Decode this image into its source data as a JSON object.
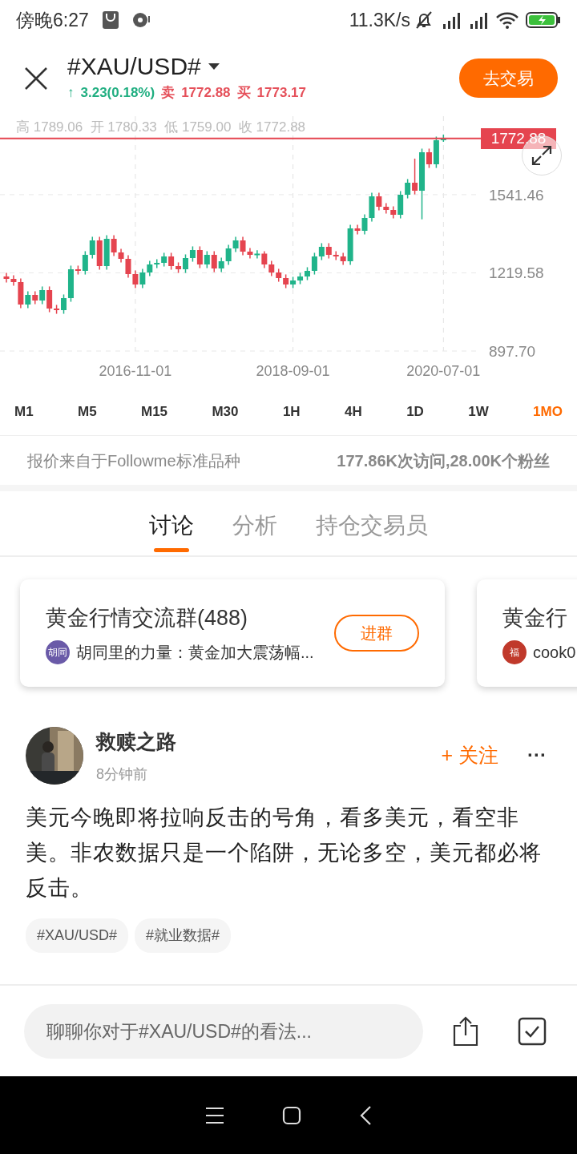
{
  "status_bar": {
    "time": "傍晚6:27",
    "net_speed": "11.3K/s"
  },
  "header": {
    "title": "#XAU/USD#",
    "arrow": "↑",
    "change": "3.23(0.18%)",
    "sell_label": "卖",
    "sell": "1772.88",
    "buy_label": "买",
    "buy": "1773.17",
    "trade_button": "去交易"
  },
  "chart": {
    "ohlc": "高 1789.06  开 1780.33  低 1759.00  收 1772.88",
    "price_tag": "1772.88",
    "chart_data": {
      "type": "candlestick",
      "grid": true,
      "ylim": [
        897.7,
        1864.6
      ],
      "yticks": [
        {
          "value": 1541.46,
          "label": "1541.46"
        },
        {
          "value": 1219.58,
          "label": "1219.58"
        },
        {
          "value": 897.7,
          "label": "897.70"
        }
      ],
      "categories": [
        null,
        null,
        null,
        null,
        null,
        null,
        null,
        null,
        null,
        null,
        null,
        null,
        null,
        null,
        null,
        null,
        null,
        null,
        "2016-11-01",
        null,
        null,
        null,
        null,
        null,
        null,
        null,
        null,
        null,
        null,
        null,
        null,
        null,
        null,
        null,
        null,
        null,
        null,
        null,
        null,
        null,
        "2018-09-01",
        null,
        null,
        null,
        null,
        null,
        null,
        null,
        null,
        null,
        null,
        null,
        null,
        null,
        null,
        null,
        null,
        null,
        null,
        null,
        null,
        "2020-07-01"
      ],
      "ohlc": [
        [
          1204.6,
          1219.6,
          1179.7,
          1194.7
        ],
        [
          1194.7,
          1209.7,
          1166.5,
          1181.5
        ],
        [
          1181.5,
          1196.5,
          1074.1,
          1089.1
        ],
        [
          1089.1,
          1143.7,
          1074.1,
          1128.7
        ],
        [
          1128.7,
          1143.7,
          1090.6,
          1105.6
        ],
        [
          1105.6,
          1163.5,
          1090.6,
          1148.5
        ],
        [
          1148.5,
          1163.5,
          1057.6,
          1072.6
        ],
        [
          1072.6,
          1087.6,
          1051.0,
          1066.0
        ],
        [
          1066.0,
          1130.5,
          1051.0,
          1115.5
        ],
        [
          1115.5,
          1249.3,
          1100.5,
          1234.3
        ],
        [
          1234.3,
          1249.3,
          1212.7,
          1227.7
        ],
        [
          1227.7,
          1308.7,
          1212.7,
          1293.7
        ],
        [
          1293.7,
          1368.1,
          1278.7,
          1353.1
        ],
        [
          1353.1,
          1368.1,
          1232.5,
          1247.5
        ],
        [
          1247.5,
          1374.7,
          1232.5,
          1359.7
        ],
        [
          1359.7,
          1374.7,
          1288.6,
          1303.6
        ],
        [
          1303.6,
          1318.6,
          1262.2,
          1277.2
        ],
        [
          1277.2,
          1292.2,
          1199.5,
          1214.5
        ],
        [
          1214.5,
          1229.5,
          1156.6,
          1171.6
        ],
        [
          1171.6,
          1236.1,
          1156.6,
          1221.1
        ],
        [
          1221.1,
          1269.1,
          1206.1,
          1254.1
        ],
        [
          1254.1,
          1275.7,
          1239.1,
          1260.7
        ],
        [
          1260.7,
          1302.1,
          1245.7,
          1287.1
        ],
        [
          1287.1,
          1302.1,
          1232.5,
          1247.5
        ],
        [
          1247.5,
          1262.5,
          1219.3,
          1234.3
        ],
        [
          1234.3,
          1295.5,
          1219.3,
          1280.5
        ],
        [
          1280.5,
          1328.5,
          1265.5,
          1313.5
        ],
        [
          1313.5,
          1328.5,
          1239.1,
          1254.1
        ],
        [
          1254.1,
          1308.7,
          1239.1,
          1293.7
        ],
        [
          1293.7,
          1308.7,
          1222.6,
          1237.6
        ],
        [
          1237.6,
          1282.3,
          1222.6,
          1267.3
        ],
        [
          1267.3,
          1335.1,
          1252.3,
          1320.1
        ],
        [
          1320.1,
          1368.1,
          1305.1,
          1353.1
        ],
        [
          1353.1,
          1368.1,
          1291.9,
          1306.9
        ],
        [
          1306.9,
          1321.9,
          1278.7,
          1293.7
        ],
        [
          1293.7,
          1312.7,
          1278.7,
          1298.7
        ],
        [
          1298.7,
          1308.7,
          1239.1,
          1254.1
        ],
        [
          1254.1,
          1269.1,
          1206.1,
          1221.1
        ],
        [
          1221.1,
          1236.1,
          1183.0,
          1198.0
        ],
        [
          1198.0,
          1213.0,
          1156.6,
          1171.6
        ],
        [
          1171.6,
          1203.1,
          1156.6,
          1188.1
        ],
        [
          1188.1,
          1219.6,
          1173.1,
          1204.6
        ],
        [
          1204.6,
          1242.7,
          1189.6,
          1227.7
        ],
        [
          1227.7,
          1302.1,
          1212.7,
          1287.1
        ],
        [
          1287.1,
          1341.7,
          1272.1,
          1326.7
        ],
        [
          1326.7,
          1341.7,
          1278.7,
          1293.7
        ],
        [
          1293.7,
          1308.7,
          1272.1,
          1287.1
        ],
        [
          1287.1,
          1302.1,
          1252.3,
          1267.3
        ],
        [
          1267.3,
          1417.6,
          1252.3,
          1402.6
        ],
        [
          1402.6,
          1417.6,
          1377.7,
          1392.7
        ],
        [
          1392.7,
          1460.5,
          1377.7,
          1445.5
        ],
        [
          1445.5,
          1549.6,
          1430.5,
          1534.6
        ],
        [
          1534.6,
          1549.6,
          1476.7,
          1491.7
        ],
        [
          1491.7,
          1506.7,
          1463.5,
          1478.5
        ],
        [
          1478.5,
          1493.5,
          1443.7,
          1458.7
        ],
        [
          1458.7,
          1556.2,
          1443.7,
          1541.2
        ],
        [
          1541.2,
          1605.7,
          1526.2,
          1590.7
        ],
        [
          1590.7,
          1690.0,
          1542.7,
          1557.7
        ],
        [
          1557.7,
          1731.1,
          1440.0,
          1716.1
        ],
        [
          1716.1,
          1731.1,
          1651.6,
          1666.6
        ],
        [
          1666.6,
          1780.6,
          1651.6,
          1765.6
        ],
        [
          1765.6,
          1789.1,
          1759.0,
          1772.9
        ]
      ]
    }
  },
  "timeframes": [
    {
      "label": "M1",
      "selected": false
    },
    {
      "label": "M5",
      "selected": false
    },
    {
      "label": "M15",
      "selected": false
    },
    {
      "label": "M30",
      "selected": false
    },
    {
      "label": "1H",
      "selected": false
    },
    {
      "label": "4H",
      "selected": false
    },
    {
      "label": "1D",
      "selected": false
    },
    {
      "label": "1W",
      "selected": false
    },
    {
      "label": "1MO",
      "selected": true
    }
  ],
  "info": {
    "source": "报价来自于Followme标准品种",
    "stats": "177.86K次访问,28.00K个粉丝"
  },
  "tabs": [
    {
      "label": "讨论",
      "selected": true
    },
    {
      "label": "分析",
      "selected": false
    },
    {
      "label": "持仓交易员",
      "selected": false
    }
  ],
  "groups": [
    {
      "title": "黄金行情交流群(488)",
      "avatar_text": "胡同",
      "color": "#6a5aa8",
      "message": "胡同里的力量：黄金加大震荡幅...",
      "button": "进群"
    },
    {
      "title": "黄金行",
      "avatar_text": "福",
      "color": "#c0392b",
      "message": "cook0"
    }
  ],
  "post": {
    "author": "救赎之路",
    "time": "8分钟前",
    "follow": "+ 关注",
    "more": "···",
    "body": "美元今晚即将拉响反击的号角，看多美元，看空非美。非农数据只是一个陷阱，无论多空，美元都必将反击。",
    "tags": [
      "#XAU/USD#",
      "#就业数据#"
    ]
  },
  "comment_bar": {
    "placeholder": "聊聊你对于#XAU/USD#的看法..."
  }
}
